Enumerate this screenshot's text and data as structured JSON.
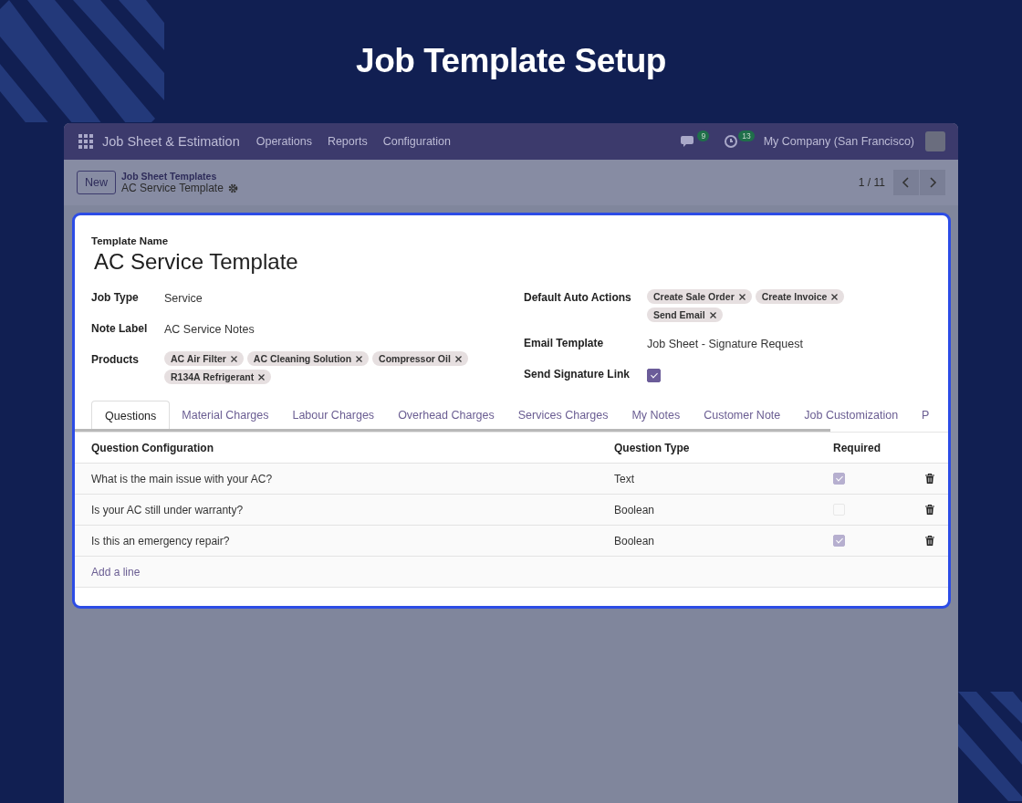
{
  "heading": "Job Template Setup",
  "navbar": {
    "app_name": "Job Sheet & Estimation",
    "menu": [
      "Operations",
      "Reports",
      "Configuration"
    ],
    "messages_count": "9",
    "activities_count": "13",
    "company": "My Company (San Francisco)"
  },
  "control_panel": {
    "new_button": "New",
    "breadcrumb": "Job Sheet Templates",
    "record_title": "AC Service Template",
    "pager": "1 / 11"
  },
  "form": {
    "name_label": "Template Name",
    "name_value": "AC Service Template",
    "left_fields": [
      {
        "label": "Job Type",
        "kind": "text",
        "value": "Service"
      },
      {
        "label": "Note Label",
        "kind": "text",
        "value": "AC Service Notes"
      },
      {
        "label": "Products",
        "kind": "tags",
        "tags": [
          "AC Air Filter",
          "AC Cleaning Solution",
          "Compressor Oil",
          "R134A Refrigerant"
        ]
      }
    ],
    "right_fields": [
      {
        "label": "Default Auto Actions",
        "kind": "tags",
        "tags": [
          "Create Sale Order",
          "Create Invoice",
          "Send Email"
        ]
      },
      {
        "label": "Email Template",
        "kind": "text",
        "value": "Job Sheet - Signature Request"
      },
      {
        "label": "Send Signature Link",
        "kind": "checkbox",
        "checked": true
      }
    ]
  },
  "tabs": [
    {
      "label": "Questions",
      "selected": true
    },
    {
      "label": "Material Charges",
      "selected": false
    },
    {
      "label": "Labour Charges",
      "selected": false
    },
    {
      "label": "Overhead Charges",
      "selected": false
    },
    {
      "label": "Services Charges",
      "selected": false
    },
    {
      "label": "My Notes",
      "selected": false
    },
    {
      "label": "Customer Note",
      "selected": false
    },
    {
      "label": "Job Customization",
      "selected": false
    },
    {
      "label": "P",
      "selected": false
    }
  ],
  "table": {
    "columns": [
      "Question Configuration",
      "Question Type",
      "Required"
    ],
    "rows": [
      {
        "question": "What is the main issue with your AC?",
        "type": "Text",
        "required": true
      },
      {
        "question": "Is your AC still under warranty?",
        "type": "Boolean",
        "required": false
      },
      {
        "question": "Is this an emergency repair?",
        "type": "Boolean",
        "required": true
      }
    ],
    "add_line": "Add a line"
  }
}
